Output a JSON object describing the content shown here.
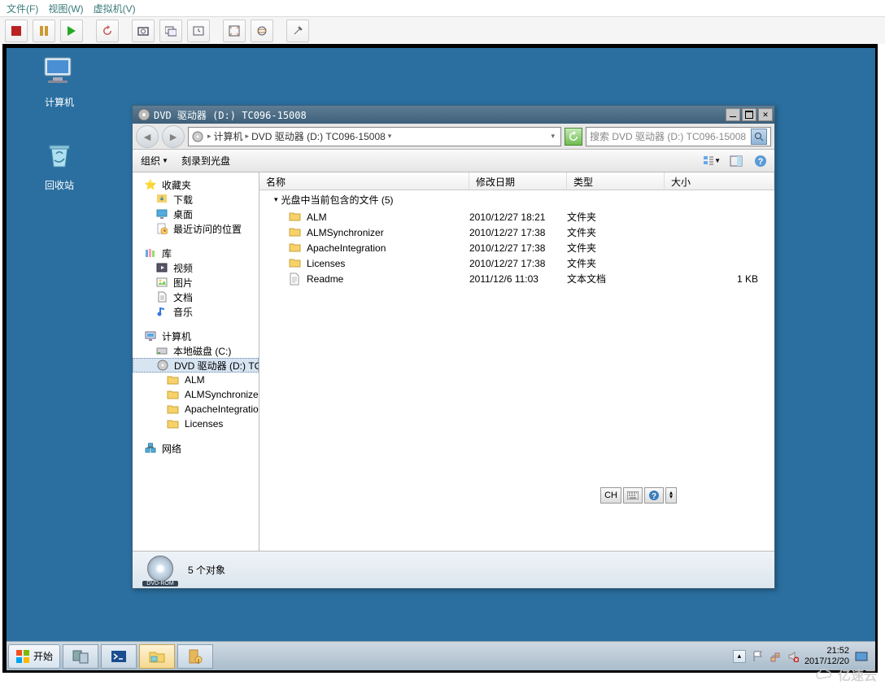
{
  "vm_menu": {
    "file": "文件(F)",
    "view": "视图(W)",
    "virtual": "虚拟机(V)"
  },
  "desktop_icons": {
    "computer": "计算机",
    "recycle": "回收站"
  },
  "explorer": {
    "title": "DVD 驱动器 (D:) TC096-15008",
    "breadcrumb": {
      "computer": "计算机",
      "drive": "DVD 驱动器 (D:) TC096-15008"
    },
    "search_placeholder": "搜索 DVD 驱动器 (D:) TC096-15008",
    "menu": {
      "organize": "组织",
      "burn": "刻录到光盘"
    },
    "tree": {
      "favorites": "收藏夹",
      "downloads": "下载",
      "desktop": "桌面",
      "recent": "最近访问的位置",
      "library": "库",
      "videos": "视频",
      "pictures": "图片",
      "documents": "文档",
      "music": "音乐",
      "computer": "计算机",
      "localdisk": "本地磁盘 (C:)",
      "dvd": "DVD 驱动器 (D:) TC",
      "alm": "ALM",
      "sync": "ALMSynchronizer",
      "apache": "ApacheIntegratio",
      "lic": "Licenses",
      "network": "网络"
    },
    "columns": {
      "name": "名称",
      "date": "修改日期",
      "type": "类型",
      "size": "大小"
    },
    "group_header": "光盘中当前包含的文件 (5)",
    "rows": [
      {
        "name": "ALM",
        "date": "2010/12/27 18:21",
        "type": "文件夹",
        "size": "",
        "icon": "folder"
      },
      {
        "name": "ALMSynchronizer",
        "date": "2010/12/27 17:38",
        "type": "文件夹",
        "size": "",
        "icon": "folder"
      },
      {
        "name": "ApacheIntegration",
        "date": "2010/12/27 17:38",
        "type": "文件夹",
        "size": "",
        "icon": "folder"
      },
      {
        "name": "Licenses",
        "date": "2010/12/27 17:38",
        "type": "文件夹",
        "size": "",
        "icon": "folder"
      },
      {
        "name": "Readme",
        "date": "2011/12/6 11:03",
        "type": "文本文档",
        "size": "1 KB",
        "icon": "txt"
      }
    ],
    "status": {
      "objects": "5 个对象",
      "dvd_label": "DVD-ROM"
    },
    "lang": {
      "ch": "CH"
    }
  },
  "taskbar": {
    "start": "开始",
    "clock_time": "21:52",
    "clock_date": "2017/12/20"
  },
  "watermark": "亿速云"
}
